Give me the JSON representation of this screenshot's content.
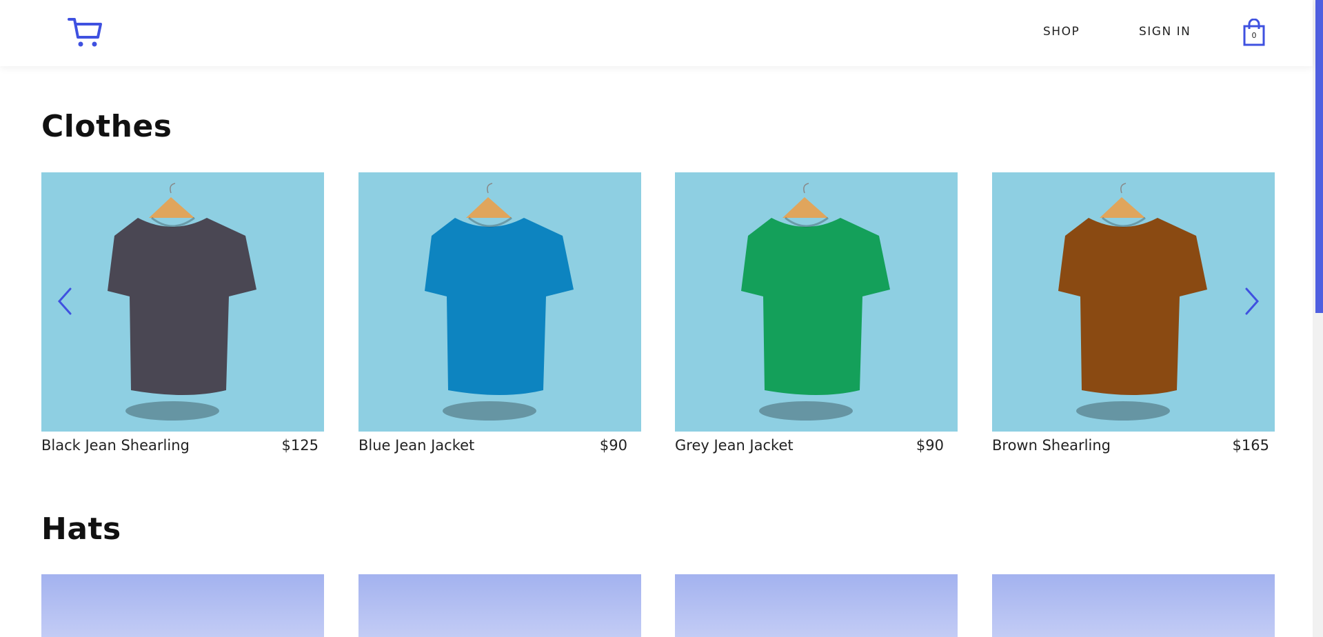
{
  "header": {
    "logo_icon": "shopping-cart-logo-icon",
    "nav": {
      "shop_label": "SHOP",
      "sign_in_label": "SIGN IN"
    },
    "cart": {
      "icon": "shopping-bag-icon",
      "count": "0"
    }
  },
  "colors": {
    "accent": "#3f51e0",
    "image_bg_clothes": "#8ecfe2",
    "image_bg_hats": "#a9b7f0"
  },
  "sections": [
    {
      "title": "Clothes",
      "carousel": {
        "prev_icon": "chevron-left-icon",
        "next_icon": "chevron-right-icon"
      },
      "items": [
        {
          "name": "Black Jean Shearling",
          "price": "$125",
          "shirt_color": "#4a4753"
        },
        {
          "name": "Blue Jean Jacket",
          "price": "$90",
          "shirt_color": "#0d84c0"
        },
        {
          "name": "Grey Jean Jacket",
          "price": "$90",
          "shirt_color": "#14a05a"
        },
        {
          "name": "Brown Shearling",
          "price": "$165",
          "shirt_color": "#8a4a12"
        }
      ]
    },
    {
      "title": "Hats",
      "items": [
        {},
        {},
        {},
        {}
      ]
    }
  ]
}
